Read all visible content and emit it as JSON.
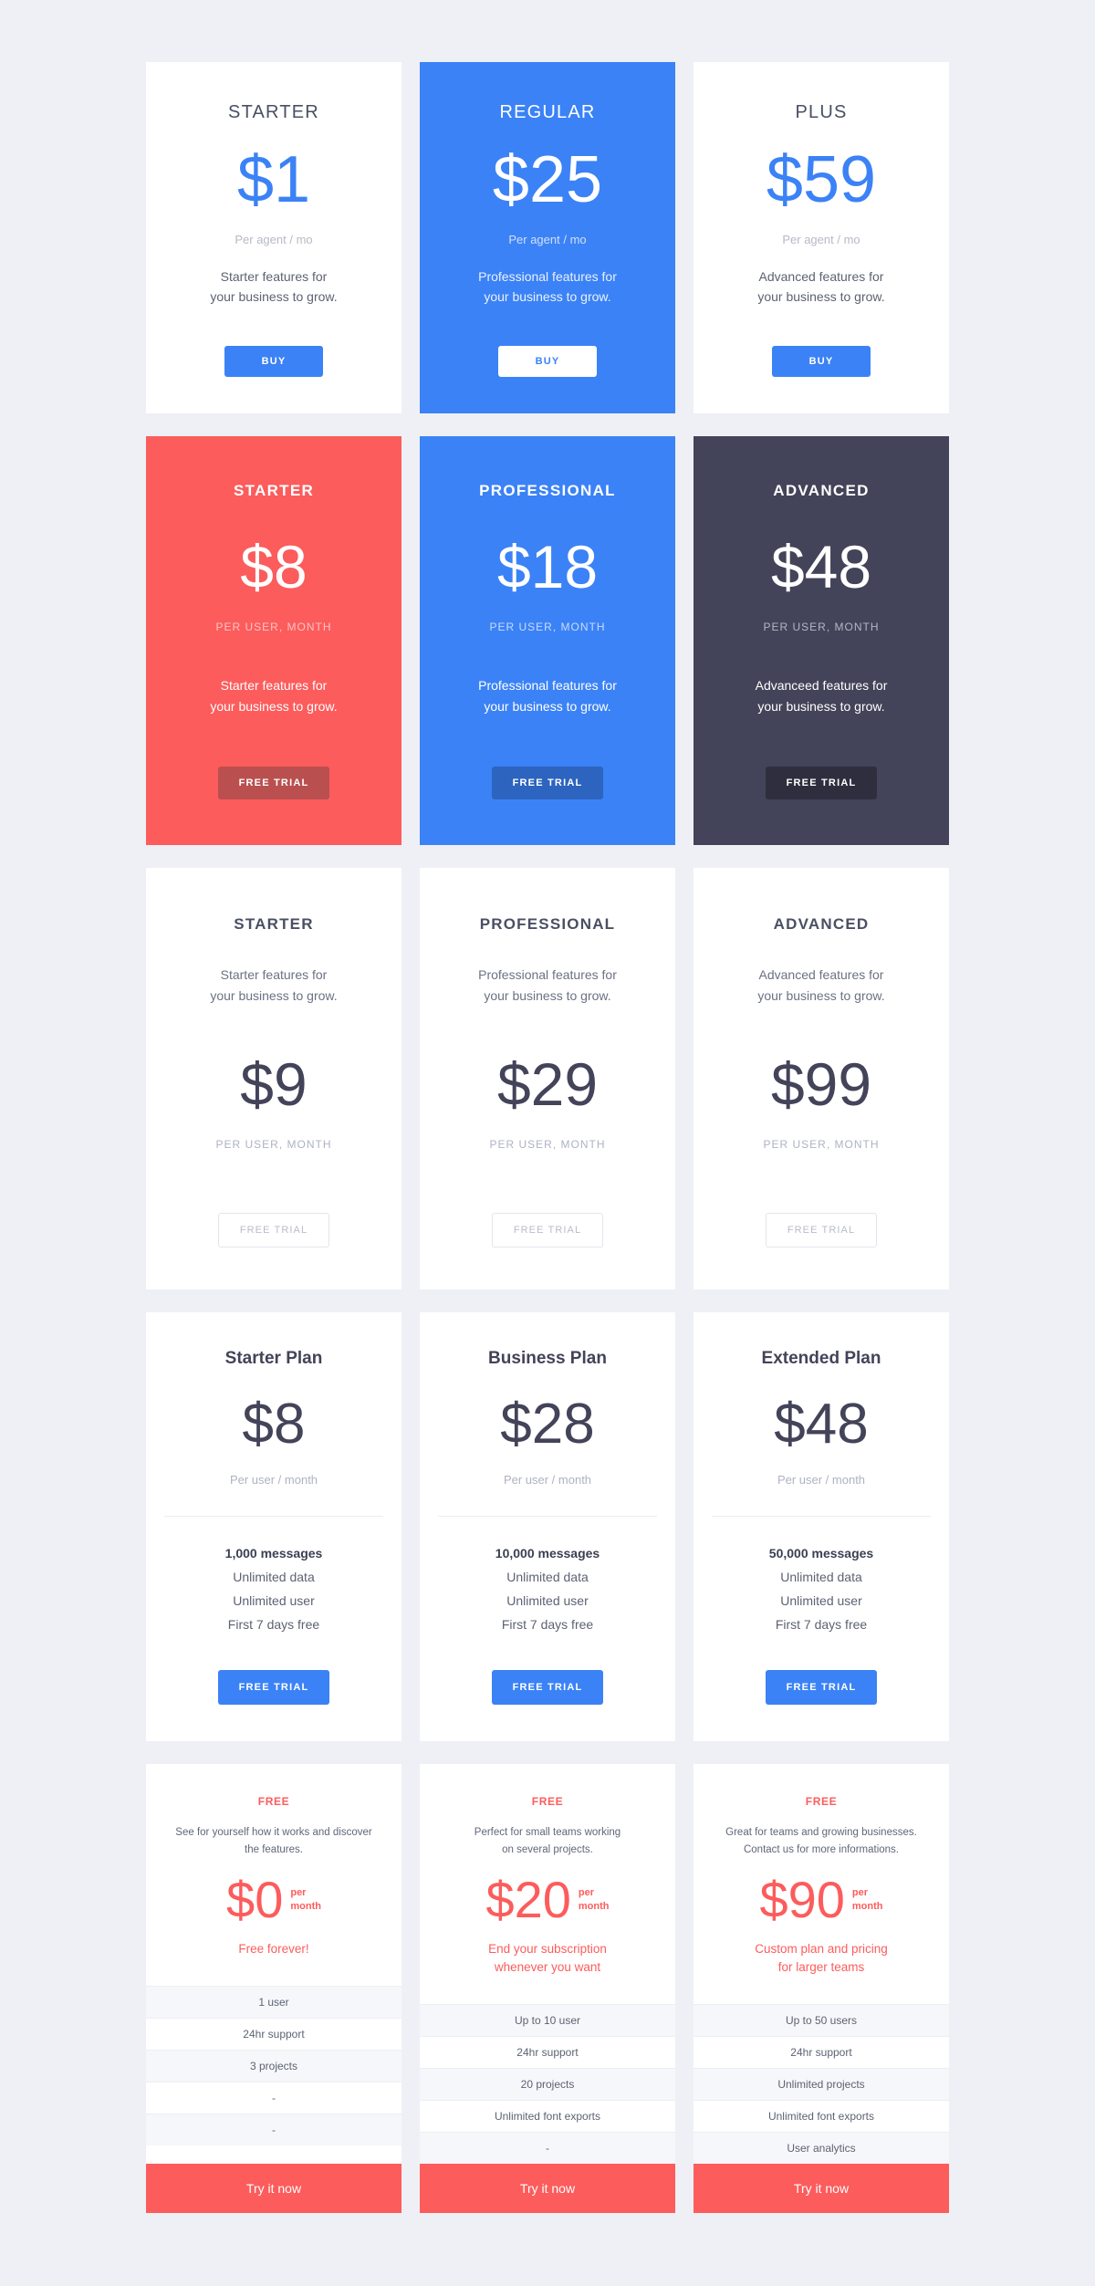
{
  "colors": {
    "page_background": "#eef0f5",
    "blue": "#3b82f6",
    "red": "#fc5c5c",
    "dark": "#434359",
    "text_dark": "#434359",
    "text_muted": "#aeb3c2"
  },
  "row1": {
    "cards": [
      {
        "title": "STARTER",
        "price": "$1",
        "per": "Per agent / mo",
        "desc_line1": "Starter features for",
        "desc_line2": "your business to grow.",
        "button": "BUY"
      },
      {
        "title": "REGULAR",
        "price": "$25",
        "per": "Per agent / mo",
        "desc_line1": "Professional features for",
        "desc_line2": "your business to grow.",
        "button": "BUY"
      },
      {
        "title": "PLUS",
        "price": "$59",
        "per": "Per agent / mo",
        "desc_line1": "Advanced features for",
        "desc_line2": "your business to grow.",
        "button": "BUY"
      }
    ]
  },
  "row2": {
    "cards": [
      {
        "title": "STARTER",
        "price": "$8",
        "per": "PER USER, MONTH",
        "desc_line1": "Starter features for",
        "desc_line2": "your business to grow.",
        "button": "FREE TRIAL",
        "bg": "#fc5c5c"
      },
      {
        "title": "PROFESSIONAL",
        "price": "$18",
        "per": "PER USER, MONTH",
        "desc_line1": "Professional features for",
        "desc_line2": "your business to grow.",
        "button": "FREE TRIAL",
        "bg": "#3b82f6"
      },
      {
        "title": "ADVANCED",
        "price": "$48",
        "per": "PER USER, MONTH",
        "desc_line1": "Advanceed features for",
        "desc_line2": "your business to grow.",
        "button": "FREE TRIAL",
        "bg": "#434359"
      }
    ]
  },
  "row3": {
    "cards": [
      {
        "title": "STARTER",
        "desc_line1": "Starter features for",
        "desc_line2": "your business to grow.",
        "price": "$9",
        "per": "PER USER, MONTH",
        "button": "FREE TRIAL"
      },
      {
        "title": "PROFESSIONAL",
        "desc_line1": "Professional features for",
        "desc_line2": "your business to grow.",
        "price": "$29",
        "per": "PER USER, MONTH",
        "button": "FREE TRIAL"
      },
      {
        "title": "ADVANCED",
        "desc_line1": "Advanced features for",
        "desc_line2": "your business to grow.",
        "price": "$99",
        "per": "PER USER, MONTH",
        "button": "FREE TRIAL"
      }
    ]
  },
  "row4": {
    "cards": [
      {
        "title": "Starter Plan",
        "price": "$8",
        "per": "Per user / month",
        "features": [
          "1,000 messages",
          "Unlimited data",
          "Unlimited user",
          "First 7 days free"
        ],
        "button": "FREE TRIAL"
      },
      {
        "title": "Business Plan",
        "price": "$28",
        "per": "Per user / month",
        "features": [
          "10,000 messages",
          "Unlimited data",
          "Unlimited user",
          "First 7 days free"
        ],
        "button": "FREE TRIAL"
      },
      {
        "title": "Extended Plan",
        "price": "$48",
        "per": "Per user / month",
        "features": [
          "50,000 messages",
          "Unlimited data",
          "Unlimited user",
          "First 7 days free"
        ],
        "button": "FREE TRIAL"
      }
    ]
  },
  "row5": {
    "cards": [
      {
        "tag": "FREE",
        "blurb_line1": "See for yourself how it works and discover",
        "blurb_line2": "the features.",
        "price": "$0",
        "unit_line1": "per",
        "unit_line2": "month",
        "tagline_line1": "Free forever!",
        "tagline_line2": "",
        "rows": [
          "1 user",
          "24hr support",
          "3 projects",
          "-",
          "-"
        ],
        "cta": "Try it now"
      },
      {
        "tag": "FREE",
        "blurb_line1": "Perfect for small teams working",
        "blurb_line2": "on several projects.",
        "price": "$20",
        "unit_line1": "per",
        "unit_line2": "month",
        "tagline_line1": "End your subscription",
        "tagline_line2": "whenever you want",
        "rows": [
          "Up to 10 user",
          "24hr support",
          "20 projects",
          "Unlimited font exports",
          "-"
        ],
        "cta": "Try it now"
      },
      {
        "tag": "FREE",
        "blurb_line1": "Great for teams and growing businesses.",
        "blurb_line2": "Contact us for more informations.",
        "price": "$90",
        "unit_line1": "per",
        "unit_line2": "month",
        "tagline_line1": "Custom plan and pricing",
        "tagline_line2": "for larger teams",
        "rows": [
          "Up to 50 users",
          "24hr support",
          "Unlimited projects",
          "Unlimited font exports",
          "User analytics"
        ],
        "cta": "Try it now"
      }
    ]
  }
}
